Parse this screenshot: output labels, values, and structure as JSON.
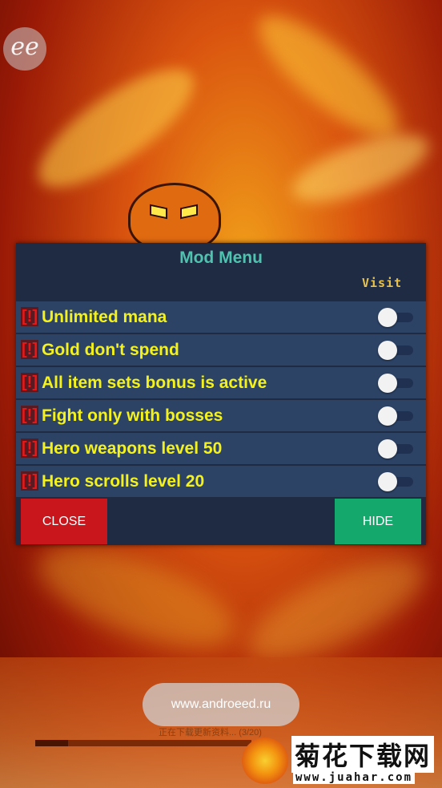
{
  "app_logo": {
    "icon": "ee-logo-icon",
    "text": "ee"
  },
  "mod_menu": {
    "title": "Mod Menu",
    "marquee": "Visit",
    "items": [
      {
        "tag": "[!]",
        "label": "Unlimited mana",
        "enabled": false
      },
      {
        "tag": "[!]",
        "label": "Gold don't spend",
        "enabled": false
      },
      {
        "tag": "[!]",
        "label": "All item sets bonus is active",
        "enabled": false
      },
      {
        "tag": "[!]",
        "label": "Fight only with bosses",
        "enabled": false
      },
      {
        "tag": "[!]",
        "label": "Hero weapons level 50",
        "enabled": false
      },
      {
        "tag": "[!]",
        "label": "Hero scrolls level 20",
        "enabled": false
      }
    ],
    "close_label": "CLOSE",
    "hide_label": "HIDE",
    "colors": {
      "close": "#c8161c",
      "hide": "#14a86c",
      "title": "#4fc3b0",
      "label": "#f4f21a"
    }
  },
  "toast": {
    "text": "www.androeed.ru"
  },
  "loading": {
    "text": "正在下载更新资料... (3/20)",
    "progress": 0.15
  },
  "watermark": {
    "title": "菊花下载网",
    "url": "www.juahar.com"
  }
}
